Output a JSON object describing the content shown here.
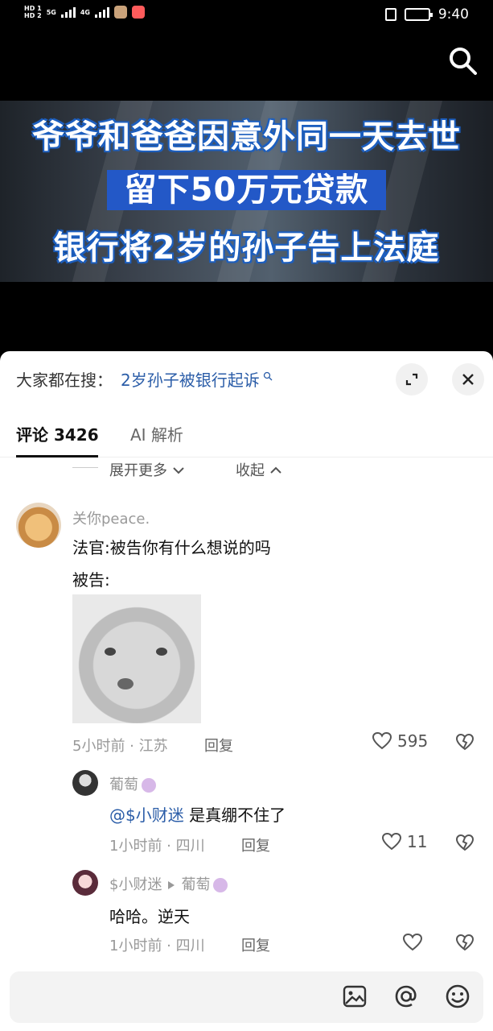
{
  "status_bar": {
    "sim1": "HD 1",
    "sim2": "HD 2",
    "net1": "5G",
    "net2": "4G",
    "time": "9:40"
  },
  "video": {
    "caption_line1": "爷爷和爸爸因意外同一天去世",
    "caption_line2": "留下50万元贷款",
    "caption_line3": "银行将2岁的孙子告上法庭"
  },
  "search_suggest": {
    "label": "大家都在搜：",
    "query": "2岁孙子被银行起诉"
  },
  "tabs": {
    "comments": "评论 3426",
    "ai": "AI 解析"
  },
  "thread_controls": {
    "expand": "展开更多",
    "collapse": "收起"
  },
  "comments": [
    {
      "user": "关你peace.",
      "line1": "法官:被告你有什么想说的吗",
      "line2": "被告:",
      "meta": "5小时前 · 江苏",
      "reply": "回复",
      "likes": "595"
    },
    {
      "user": "葡萄",
      "mention": "@$小财迷",
      "text": " 是真绷不住了",
      "meta": "1小时前 · 四川",
      "reply": "回复",
      "likes": "11"
    },
    {
      "user": "$小财迷",
      "reply_to": "葡萄",
      "text": "哈哈。逆天",
      "meta": "1小时前 · 四川",
      "reply": "回复",
      "likes": ""
    }
  ],
  "input": {
    "placeholder": ""
  },
  "icons": [
    "search-icon",
    "expand-icon",
    "close-icon",
    "heart-icon",
    "dislike-icon",
    "image-icon",
    "at-icon",
    "emoji-icon"
  ]
}
